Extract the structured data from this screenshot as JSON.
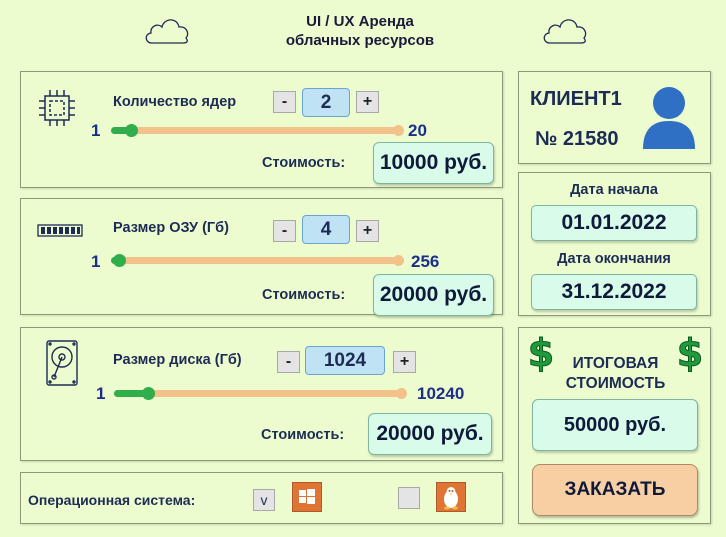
{
  "header": {
    "title_line1": "UI / UX Аренда",
    "title_line2": "облачных ресурсов"
  },
  "cpu": {
    "icon": "cpu-chip-icon",
    "label": "Количество ядер",
    "minus": "-",
    "plus": "+",
    "value": "2",
    "min": "1",
    "max": "20",
    "slider_fraction": 0.053,
    "cost_label": "Стоимость:",
    "cost": "10000 руб."
  },
  "ram": {
    "icon": "ram-module-icon",
    "label": "Размер ОЗУ (Гб)",
    "minus": "-",
    "plus": "+",
    "value": "4",
    "min": "1",
    "max": "256",
    "slider_fraction": 0.012,
    "cost_label": "Стоимость:",
    "cost": "20000 руб."
  },
  "disk": {
    "icon": "hard-disk-icon",
    "label": "Размер диска (Гб)",
    "minus": "-",
    "plus": "+",
    "value": "1024",
    "min": "1",
    "max": "10240",
    "slider_fraction": 0.1,
    "cost_label": "Стоимость:",
    "cost": "20000 руб."
  },
  "os": {
    "label": "Операционная система:",
    "windows_checkbox": "v",
    "windows_icon": "windows-logo-icon",
    "linux_icon": "linux-penguin-icon"
  },
  "client": {
    "name": "КЛИЕНТ1",
    "number": "№ 21580",
    "icon": "user-avatar-icon"
  },
  "dates": {
    "start_label": "Дата начала",
    "start": "01.01.2022",
    "end_label": "Дата окончания",
    "end": "31.12.2022"
  },
  "total": {
    "icon": "dollar-icon",
    "label_line1": "ИТОГОВАЯ",
    "label_line2": "СТОИМОСТЬ",
    "value": "50000 руб.",
    "order_button": "ЗАКАЗАТЬ"
  },
  "colors": {
    "background": "#ecfccf",
    "slider_fill": "#2fae4b",
    "slider_track": "#f2c28a",
    "value_box": "#d8fbea",
    "stepper_value": "#bfe2f5",
    "order_button": "#f8cea3",
    "avatar": "#2f6fc4"
  }
}
